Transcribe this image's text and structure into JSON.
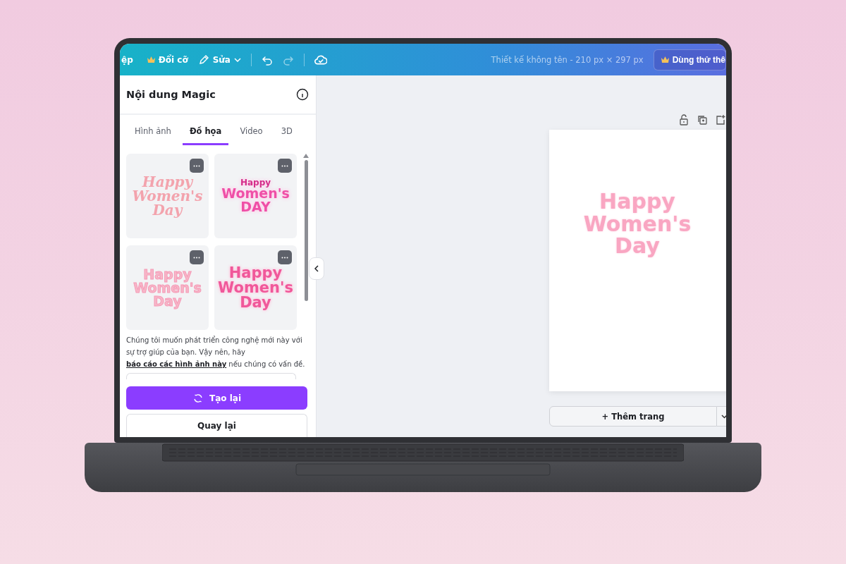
{
  "topbar": {
    "cut_label": "ệp",
    "menu": [
      {
        "kind": "premium",
        "label": "Đổi cỡ"
      },
      {
        "kind": "edit",
        "label": "Sửa"
      }
    ],
    "title": "Thiết kế không tên - 210 px × 297 px",
    "trial_button": "Dùng thử thê"
  },
  "panel": {
    "title": "Nội dung Magic",
    "tabs": [
      {
        "label": "Hình ảnh",
        "selected": false
      },
      {
        "label": "Đồ họa",
        "selected": true
      },
      {
        "label": "Video",
        "selected": false
      },
      {
        "label": "3D",
        "selected": false
      }
    ],
    "graphics": [
      {
        "kind": "script",
        "lines": [
          "Happy",
          "Women's",
          "Day"
        ]
      },
      {
        "kind": "bold",
        "lines": [
          "Happy",
          "Women's",
          "DAY"
        ]
      },
      {
        "kind": "bubble",
        "lines": [
          "Happy",
          "Women's",
          "Day"
        ]
      },
      {
        "kind": "hot",
        "lines": [
          "Happy",
          "Women's",
          "Day"
        ]
      }
    ],
    "notice_before": "Chúng tôi muốn phát triển công nghệ mới này với sự trợ giúp của bạn. Vậy nên, hãy ",
    "notice_link": "báo cáo các hình ảnh này",
    "notice_after": " nếu chúng có vấn đề.",
    "primary_button": "Tạo lại",
    "secondary_button": "Quay lại"
  },
  "canvas": {
    "design_lines": [
      "Happy",
      "Women's",
      "Day"
    ],
    "add_page_button": "+ Thêm trang"
  }
}
